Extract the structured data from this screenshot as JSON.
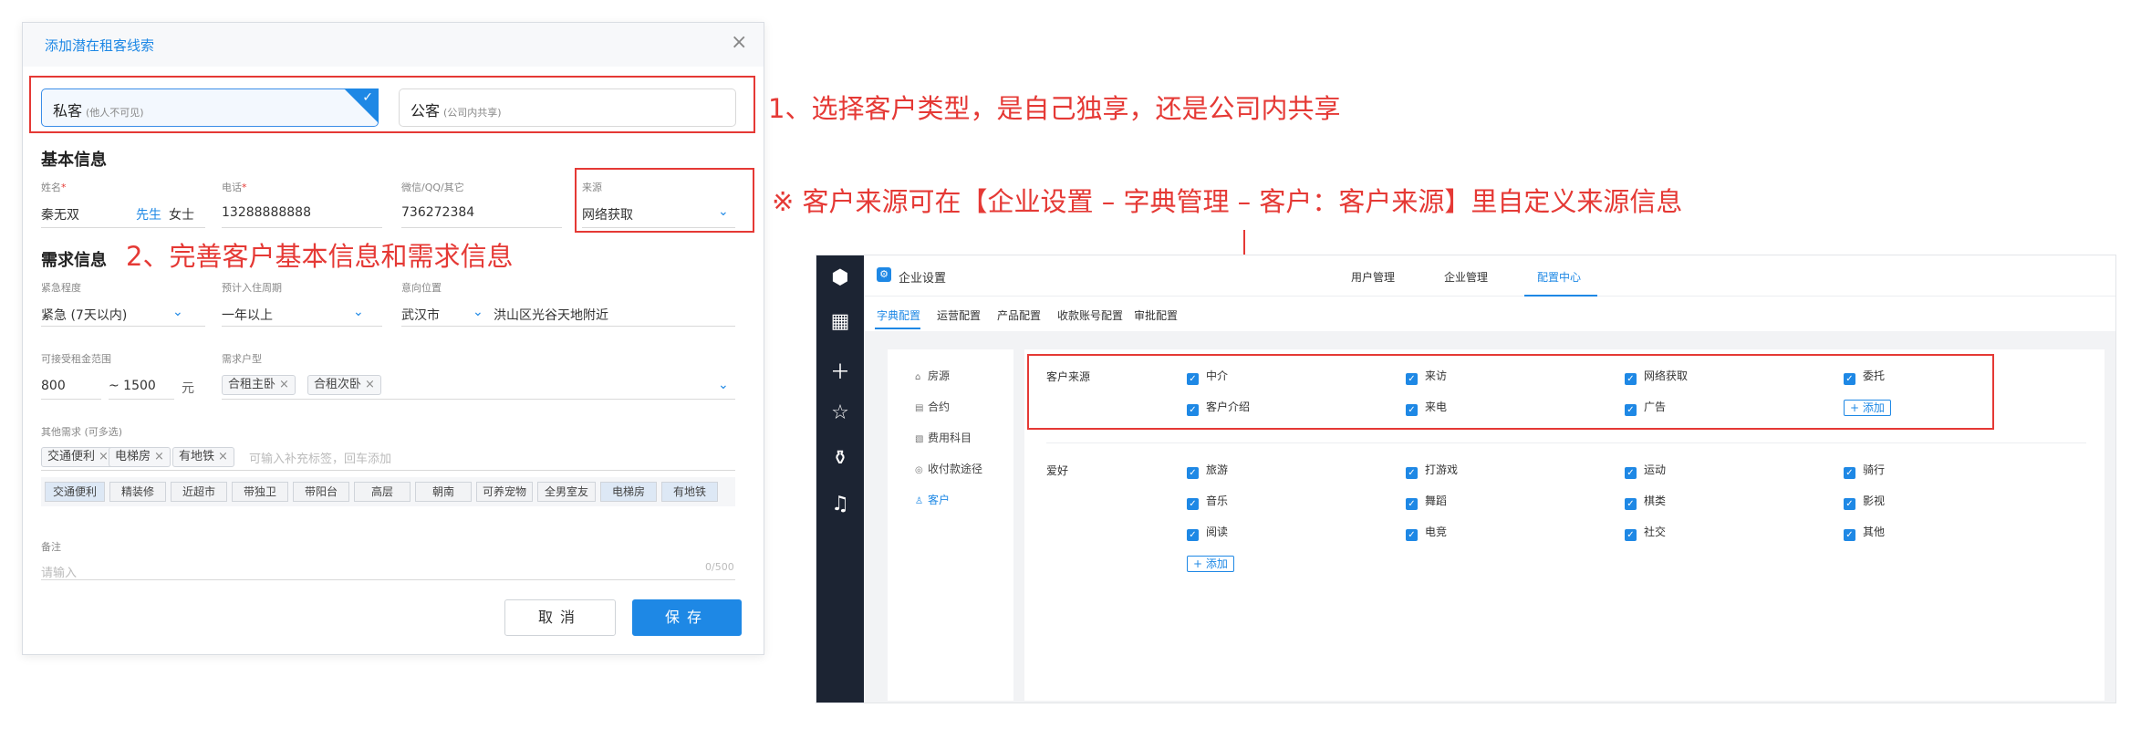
{
  "dialog": {
    "title": "添加潜在租客线索",
    "close_icon": "×",
    "customer_types": [
      {
        "name": "私客",
        "sub": "(他人不可见)",
        "selected": true
      },
      {
        "name": "公客",
        "sub": "(公司内共享)",
        "selected": false
      }
    ],
    "basic": {
      "section_title": "基本信息",
      "name_label": "姓名",
      "name_value": "秦无双",
      "gender_male": "先生",
      "gender_female": "女士",
      "phone_label": "电话",
      "phone_value": "13288888888",
      "wechat_label": "微信/QQ/其它",
      "wechat_value": "736272384",
      "source_label": "来源",
      "source_value": "网络获取",
      "required_mark": "*"
    },
    "demand": {
      "section_title": "需求信息",
      "urgency_label": "紧急程度",
      "urgency_value": "紧急 (7天以内)",
      "period_label": "预计入住周期",
      "period_value": "一年以上",
      "location_label": "意向位置",
      "city_value": "武汉市",
      "area_value": "洪山区光谷天地附近",
      "rent_label": "可接受租金范围",
      "rent_min": "800",
      "rent_sep": "~ 1500",
      "rent_unit": "元",
      "room_label": "需求户型",
      "room_tags": [
        "合租主卧",
        "合租次卧"
      ],
      "other_label": "其他需求 (可多选)",
      "other_tags": [
        "交通便利",
        "电梯房",
        "有地铁"
      ],
      "other_placeholder": "可输入补充标签，回车添加",
      "options": [
        "交通便利",
        "精装修",
        "近超市",
        "带独卫",
        "带阳台",
        "高层",
        "朝南",
        "可养宠物",
        "全男室友",
        "电梯房",
        "有地铁"
      ],
      "note_label": "备注",
      "note_placeholder": "请输入",
      "note_count": "0/500"
    },
    "cancel_label": "取消",
    "save_label": "保存"
  },
  "annotations": {
    "step1": "1、选择客户类型，是自己独享，还是公司内共享",
    "step2": "2、完善客户基本信息和需求信息",
    "note": "※ 客户来源可在【企业设置 – 字典管理 – 客户：客户来源】里自定义来源信息"
  },
  "settings": {
    "title": "企业设置",
    "top_nav": [
      "用户管理",
      "企业管理",
      "配置中心"
    ],
    "sub_nav": [
      "字典配置",
      "运营配置",
      "产品配置",
      "收款账号配置",
      "审批配置"
    ],
    "left_menu": [
      "房源",
      "合约",
      "费用科目",
      "收付款途径",
      "客户"
    ],
    "source_row": {
      "title": "客户来源",
      "items": [
        "中介",
        "来访",
        "网络获取",
        "委托",
        "客户介绍",
        "来电",
        "广告"
      ],
      "add_label": "+ 添加"
    },
    "hobby_row": {
      "title": "爱好",
      "items": [
        "旅游",
        "打游戏",
        "运动",
        "骑行",
        "音乐",
        "舞蹈",
        "棋类",
        "影视",
        "阅读",
        "电竞",
        "社交",
        "其他"
      ],
      "add_label": "+ 添加"
    }
  }
}
